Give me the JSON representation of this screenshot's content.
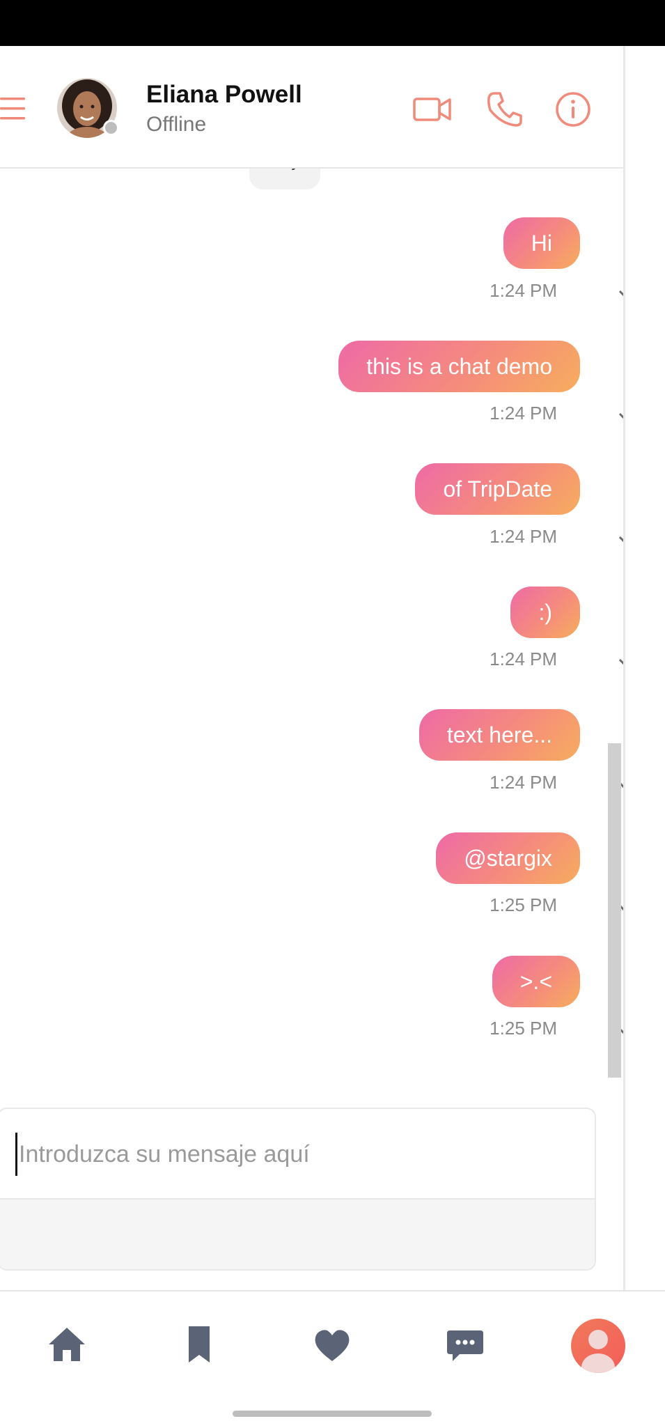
{
  "header": {
    "contact_name": "Eliana Powell",
    "contact_status": "Offline"
  },
  "date_chip": "Hoy",
  "messages": [
    {
      "text": "Hi",
      "time": "1:24 PM"
    },
    {
      "text": "this is a chat demo",
      "time": "1:24 PM"
    },
    {
      "text": "of TripDate",
      "time": "1:24 PM"
    },
    {
      "text": ":)",
      "time": "1:24 PM"
    },
    {
      "text": "text here...",
      "time": "1:24 PM"
    },
    {
      "text": "@stargix",
      "time": "1:25 PM"
    },
    {
      "text": ">.<",
      "time": "1:25 PM"
    }
  ],
  "composer": {
    "placeholder": "Introduzca su mensaje aquí"
  },
  "colors": {
    "accent": "#f08a7a",
    "bubble_start": "#ee6aa7",
    "bubble_end": "#f7ad5d",
    "heart": "#e53935",
    "nav_icon": "#5b6477"
  },
  "icons": {
    "header": [
      "menu-icon",
      "video-call-icon",
      "phone-icon",
      "info-icon"
    ],
    "composer": [
      "plus-icon",
      "emoji-icon",
      "heart-icon"
    ],
    "nav": [
      "home-icon",
      "bookmark-icon",
      "heart-icon",
      "chat-icon",
      "profile-icon"
    ]
  }
}
